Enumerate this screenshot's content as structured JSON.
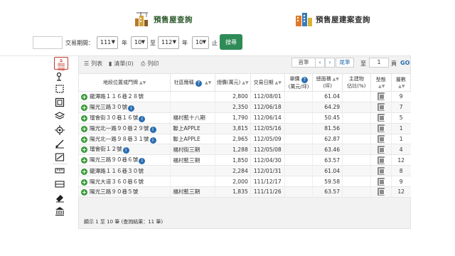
{
  "tabs": [
    {
      "label": "預售屋查詢",
      "icon": "construction-crane-icon"
    },
    {
      "label": "預售屋建案查詢",
      "icon": "buildings-icon"
    }
  ],
  "filter": {
    "period_label": "交易期間：",
    "from_year": "111",
    "year_unit": "年",
    "from_month": "10",
    "to_label": "至",
    "to_year": "112",
    "to_month": "10",
    "end_label": "止",
    "search_label": "搜尋"
  },
  "toolbar": {
    "list_label": "列表",
    "list_icon": "list-icon",
    "checklist_label": "清單(0)",
    "bookmark_icon": "bookmark-icon",
    "print_label": "列印",
    "print_icon": "printer-icon"
  },
  "pager": {
    "first": "首筆",
    "prev": "‹",
    "next": "›",
    "last": "尾筆",
    "to_label": "至",
    "page": "1",
    "page_unit": "頁",
    "go": "GO"
  },
  "tools": {
    "map_label_1": "展開",
    "map_label_2": "地圖",
    "map_icon": "external-link-icon",
    "items": [
      "street-view-icon",
      "area-select-icon",
      "frame-icon",
      "layers-icon",
      "locate-icon",
      "measure-icon",
      "distance-icon",
      "ruler-icon",
      "line-icon",
      "eraser-icon",
      "landmark-icon"
    ]
  },
  "table": {
    "headers": {
      "address": "地段位置或門牌",
      "community": "社區簡稱",
      "total_price": "總價(萬元)",
      "date": "交易日期",
      "unit_price_1": "單價",
      "unit_price_2": "(萬元/坪)",
      "area_1": "總面積",
      "area_2": "(坪)",
      "main_ratio_1": "主建物",
      "main_ratio_2": "佔比(%)",
      "type": "型態",
      "floor": "層數"
    },
    "rows": [
      {
        "address": "龍潭路１１６巷２８號",
        "info": false,
        "community": "",
        "total": "2,800",
        "date": "112/08/01",
        "unit": "",
        "area": "61.04",
        "ratio": "",
        "floor": "9"
      },
      {
        "address": "陽光三路３０號",
        "info": true,
        "community": "",
        "total": "2,350",
        "date": "112/06/18",
        "unit": "",
        "area": "64.29",
        "ratio": "",
        "floor": "7"
      },
      {
        "address": "瑠會街３０巷１６號",
        "info": true,
        "community": "福村藍十八期",
        "total": "1,790",
        "date": "112/06/14",
        "unit": "",
        "area": "50.45",
        "ratio": "",
        "floor": "5"
      },
      {
        "address": "陽光北一路９０巷２９號",
        "info": true,
        "community": "聯上APPLE",
        "total": "3,815",
        "date": "112/05/16",
        "unit": "",
        "area": "81.56",
        "ratio": "",
        "floor": "1"
      },
      {
        "address": "陽光北一路９８巷３１號",
        "info": true,
        "community": "聯上APPLE",
        "total": "2,965",
        "date": "112/05/09",
        "unit": "",
        "area": "62.87",
        "ratio": "",
        "floor": "1"
      },
      {
        "address": "瑠會街１２號",
        "info": true,
        "community": "福村街三期",
        "total": "1,288",
        "date": "112/05/08",
        "unit": "",
        "area": "63.46",
        "ratio": "",
        "floor": "4"
      },
      {
        "address": "陽光三路９０巷６號",
        "info": true,
        "community": "福村藍三期",
        "total": "1,850",
        "date": "112/04/30",
        "unit": "",
        "area": "63.57",
        "ratio": "",
        "floor": "12"
      },
      {
        "address": "龍潭路１１６巷３０號",
        "info": false,
        "community": "",
        "total": "2,284",
        "date": "112/01/31",
        "unit": "",
        "area": "61.04",
        "ratio": "",
        "floor": "8"
      },
      {
        "address": "陽光大道３６０巷６號",
        "info": false,
        "community": "",
        "total": "2,000",
        "date": "111/12/17",
        "unit": "",
        "area": "59.58",
        "ratio": "",
        "floor": "9"
      },
      {
        "address": "陽光三路９０巷５號",
        "info": false,
        "community": "福村藍三期",
        "total": "1,835",
        "date": "111/11/26",
        "unit": "",
        "area": "63.57",
        "ratio": "",
        "floor": "12"
      }
    ]
  },
  "footer": "顯示 1 至 10 筆 (查詢結果：11 筆)"
}
